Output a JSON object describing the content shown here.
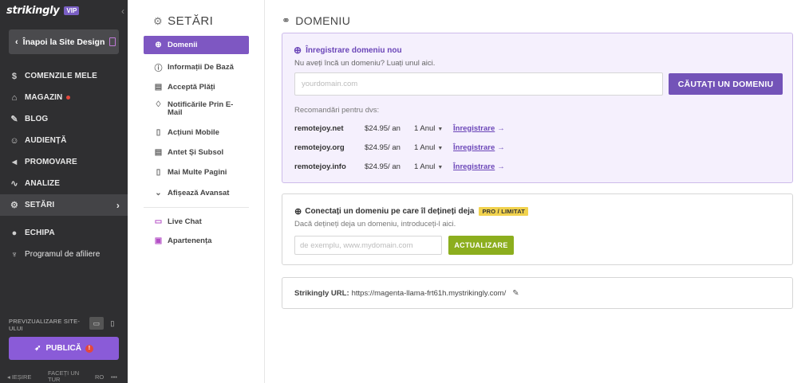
{
  "sidebar": {
    "logo": "strikingly",
    "vip": "VIP",
    "back_label": "Înapoi la Site Design",
    "items": [
      {
        "label": "COMENZILE MELE",
        "icon": "dollar-icon"
      },
      {
        "label": "MAGAZIN",
        "icon": "store-icon",
        "dot": true
      },
      {
        "label": "BLOG",
        "icon": "pen-icon"
      },
      {
        "label": "AUDIENȚĂ",
        "icon": "people-icon"
      },
      {
        "label": "PROMOVARE",
        "icon": "megaphone-icon"
      },
      {
        "label": "ANALIZE",
        "icon": "chart-icon"
      },
      {
        "label": "SETĂRI",
        "icon": "gear-icon",
        "active": true
      },
      {
        "label": "ECHIPA",
        "icon": "team-icon"
      },
      {
        "label": "Programul de afiliere",
        "icon": "trophy-icon"
      }
    ],
    "preview_label": "PREVIZUALIZARE SITE-ULUI",
    "publish_label": "PUBLICĂ",
    "publish_warn": "!",
    "bottom": {
      "exit": "◂ IEȘIRE",
      "tour": "FACEȚI UN TUR",
      "lang": "RO",
      "more": "•••"
    }
  },
  "settings": {
    "title": "SETĂRI",
    "items": [
      {
        "label": "Domenii",
        "icon": "globe-icon",
        "active": true
      },
      {
        "label": "Informații De Bază",
        "icon": "info-icon"
      },
      {
        "label": "Acceptă Plăți",
        "icon": "card-icon"
      },
      {
        "label": "Notificările Prin E-Mail",
        "icon": "bell-icon"
      },
      {
        "label": "Acțiuni Mobile",
        "icon": "mobile-icon"
      },
      {
        "label": "Antet Și Subsol",
        "icon": "layout-icon"
      },
      {
        "label": "Mai Multe Pagini",
        "icon": "pages-icon"
      },
      {
        "label": "Afișează Avansat",
        "icon": "chevron-down-icon"
      },
      {
        "label": "Live Chat",
        "icon": "chat-icon"
      },
      {
        "label": "Apartenența",
        "icon": "member-icon"
      }
    ]
  },
  "main": {
    "title": "DOMENIU",
    "register": {
      "heading": "Înregistrare domeniu nou",
      "subtitle": "Nu aveți încă un domeniu? Luați unul aici.",
      "placeholder": "yourdomain.com",
      "button": "CĂUTAȚI UN DOMENIU",
      "rec_label": "Recomandări pentru dvs:",
      "recommendations": [
        {
          "domain": "remotejoy.net",
          "price": "$24.95/ an",
          "term": "1 Anul",
          "action": "Înregistrare"
        },
        {
          "domain": "remotejoy.org",
          "price": "$24.95/ an",
          "term": "1 Anul",
          "action": "Înregistrare"
        },
        {
          "domain": "remotejoy.info",
          "price": "$24.95/ an",
          "term": "1 Anul",
          "action": "Înregistrare"
        }
      ]
    },
    "connect": {
      "heading": "Conectați un domeniu pe care îl dețineți deja",
      "badge": "PRO / LIMITAT",
      "subtitle": "Dacă dețineți deja un domeniu, introduceți-l aici.",
      "placeholder": "de exemplu, www.mydomain.com",
      "button": "ACTUALIZARE"
    },
    "url": {
      "label": "Strikingly URL:",
      "value": "https://magenta-llama-frt61h.mystrikingly.com/"
    }
  },
  "colors": {
    "accent": "#7e57c2",
    "sidebar_bg": "#2f2f31",
    "update_green": "#8cae1e"
  }
}
